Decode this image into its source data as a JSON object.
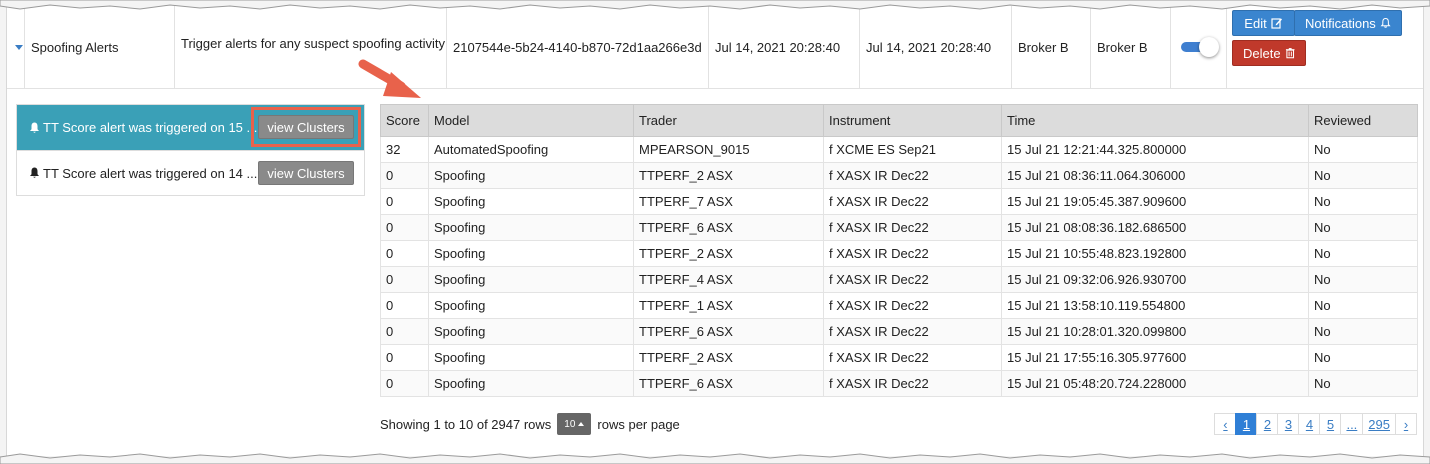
{
  "alert_row": {
    "name": "Spoofing Alerts",
    "description": "Trigger alerts for any suspect spoofing activity",
    "id": "2107544e-5b24-4140-b870-72d1aa266e3d",
    "created": "Jul 14, 2021 20:28:40",
    "modified": "Jul 14, 2021 20:28:40",
    "owner": "Broker B",
    "assignee": "Broker B",
    "enabled": true,
    "edit_label": "Edit",
    "notifications_label": "Notifications",
    "delete_label": "Delete"
  },
  "alerts": [
    {
      "text": "TT Score alert was triggered on 15 ...",
      "button": "view Clusters",
      "active": true
    },
    {
      "text": "TT Score alert was triggered on 14 ...",
      "button": "view Clusters",
      "active": false
    }
  ],
  "table": {
    "columns": [
      "Score",
      "Model",
      "Trader",
      "Instrument",
      "Time",
      "Reviewed"
    ],
    "rows": [
      [
        "32",
        "AutomatedSpoofing",
        "MPEARSON_9015",
        "f XCME ES Sep21",
        "15 Jul 21 12:21:44.325.800000",
        "No"
      ],
      [
        "0",
        "Spoofing",
        "TTPERF_2 ASX",
        "f XASX IR Dec22",
        "15 Jul 21 08:36:11.064.306000",
        "No"
      ],
      [
        "0",
        "Spoofing",
        "TTPERF_7 ASX",
        "f XASX IR Dec22",
        "15 Jul 21 19:05:45.387.909600",
        "No"
      ],
      [
        "0",
        "Spoofing",
        "TTPERF_6 ASX",
        "f XASX IR Dec22",
        "15 Jul 21 08:08:36.182.686500",
        "No"
      ],
      [
        "0",
        "Spoofing",
        "TTPERF_2 ASX",
        "f XASX IR Dec22",
        "15 Jul 21 10:55:48.823.192800",
        "No"
      ],
      [
        "0",
        "Spoofing",
        "TTPERF_4 ASX",
        "f XASX IR Dec22",
        "15 Jul 21 09:32:06.926.930700",
        "No"
      ],
      [
        "0",
        "Spoofing",
        "TTPERF_1 ASX",
        "f XASX IR Dec22",
        "15 Jul 21 13:58:10.119.554800",
        "No"
      ],
      [
        "0",
        "Spoofing",
        "TTPERF_6 ASX",
        "f XASX IR Dec22",
        "15 Jul 21 10:28:01.320.099800",
        "No"
      ],
      [
        "0",
        "Spoofing",
        "TTPERF_2 ASX",
        "f XASX IR Dec22",
        "15 Jul 21 17:55:16.305.977600",
        "No"
      ],
      [
        "0",
        "Spoofing",
        "TTPERF_6 ASX",
        "f XASX IR Dec22",
        "15 Jul 21 05:48:20.724.228000",
        "No"
      ]
    ]
  },
  "footer": {
    "showing": "Showing 1 to 10 of 2947 rows",
    "page_size": "10",
    "rows_per_page": "rows per page",
    "pages": [
      "‹",
      "1",
      "2",
      "3",
      "4",
      "5",
      "...",
      "295",
      "›"
    ],
    "current_page": "1"
  },
  "colors": {
    "active_alert": "#3aa0b7",
    "primary": "#3a85cf",
    "danger": "#c0392b",
    "callout": "#e8624b"
  }
}
